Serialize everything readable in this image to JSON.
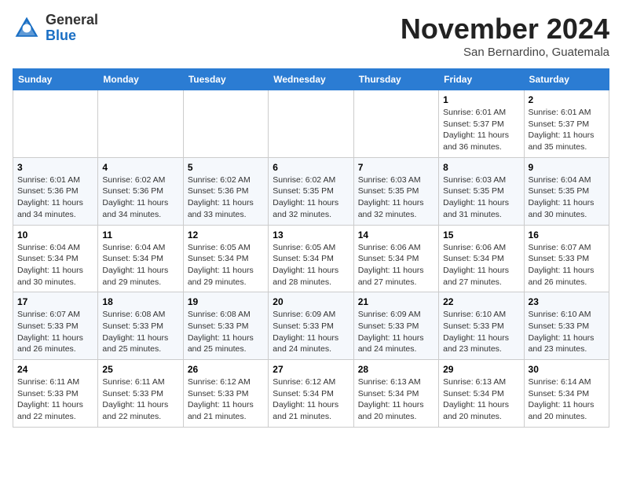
{
  "header": {
    "logo_line1": "General",
    "logo_line2": "Blue",
    "month": "November 2024",
    "location": "San Bernardino, Guatemala"
  },
  "weekdays": [
    "Sunday",
    "Monday",
    "Tuesday",
    "Wednesday",
    "Thursday",
    "Friday",
    "Saturday"
  ],
  "weeks": [
    [
      {
        "day": "",
        "info": ""
      },
      {
        "day": "",
        "info": ""
      },
      {
        "day": "",
        "info": ""
      },
      {
        "day": "",
        "info": ""
      },
      {
        "day": "",
        "info": ""
      },
      {
        "day": "1",
        "info": "Sunrise: 6:01 AM\nSunset: 5:37 PM\nDaylight: 11 hours and 36 minutes."
      },
      {
        "day": "2",
        "info": "Sunrise: 6:01 AM\nSunset: 5:37 PM\nDaylight: 11 hours and 35 minutes."
      }
    ],
    [
      {
        "day": "3",
        "info": "Sunrise: 6:01 AM\nSunset: 5:36 PM\nDaylight: 11 hours and 34 minutes."
      },
      {
        "day": "4",
        "info": "Sunrise: 6:02 AM\nSunset: 5:36 PM\nDaylight: 11 hours and 34 minutes."
      },
      {
        "day": "5",
        "info": "Sunrise: 6:02 AM\nSunset: 5:36 PM\nDaylight: 11 hours and 33 minutes."
      },
      {
        "day": "6",
        "info": "Sunrise: 6:02 AM\nSunset: 5:35 PM\nDaylight: 11 hours and 32 minutes."
      },
      {
        "day": "7",
        "info": "Sunrise: 6:03 AM\nSunset: 5:35 PM\nDaylight: 11 hours and 32 minutes."
      },
      {
        "day": "8",
        "info": "Sunrise: 6:03 AM\nSunset: 5:35 PM\nDaylight: 11 hours and 31 minutes."
      },
      {
        "day": "9",
        "info": "Sunrise: 6:04 AM\nSunset: 5:35 PM\nDaylight: 11 hours and 30 minutes."
      }
    ],
    [
      {
        "day": "10",
        "info": "Sunrise: 6:04 AM\nSunset: 5:34 PM\nDaylight: 11 hours and 30 minutes."
      },
      {
        "day": "11",
        "info": "Sunrise: 6:04 AM\nSunset: 5:34 PM\nDaylight: 11 hours and 29 minutes."
      },
      {
        "day": "12",
        "info": "Sunrise: 6:05 AM\nSunset: 5:34 PM\nDaylight: 11 hours and 29 minutes."
      },
      {
        "day": "13",
        "info": "Sunrise: 6:05 AM\nSunset: 5:34 PM\nDaylight: 11 hours and 28 minutes."
      },
      {
        "day": "14",
        "info": "Sunrise: 6:06 AM\nSunset: 5:34 PM\nDaylight: 11 hours and 27 minutes."
      },
      {
        "day": "15",
        "info": "Sunrise: 6:06 AM\nSunset: 5:34 PM\nDaylight: 11 hours and 27 minutes."
      },
      {
        "day": "16",
        "info": "Sunrise: 6:07 AM\nSunset: 5:33 PM\nDaylight: 11 hours and 26 minutes."
      }
    ],
    [
      {
        "day": "17",
        "info": "Sunrise: 6:07 AM\nSunset: 5:33 PM\nDaylight: 11 hours and 26 minutes."
      },
      {
        "day": "18",
        "info": "Sunrise: 6:08 AM\nSunset: 5:33 PM\nDaylight: 11 hours and 25 minutes."
      },
      {
        "day": "19",
        "info": "Sunrise: 6:08 AM\nSunset: 5:33 PM\nDaylight: 11 hours and 25 minutes."
      },
      {
        "day": "20",
        "info": "Sunrise: 6:09 AM\nSunset: 5:33 PM\nDaylight: 11 hours and 24 minutes."
      },
      {
        "day": "21",
        "info": "Sunrise: 6:09 AM\nSunset: 5:33 PM\nDaylight: 11 hours and 24 minutes."
      },
      {
        "day": "22",
        "info": "Sunrise: 6:10 AM\nSunset: 5:33 PM\nDaylight: 11 hours and 23 minutes."
      },
      {
        "day": "23",
        "info": "Sunrise: 6:10 AM\nSunset: 5:33 PM\nDaylight: 11 hours and 23 minutes."
      }
    ],
    [
      {
        "day": "24",
        "info": "Sunrise: 6:11 AM\nSunset: 5:33 PM\nDaylight: 11 hours and 22 minutes."
      },
      {
        "day": "25",
        "info": "Sunrise: 6:11 AM\nSunset: 5:33 PM\nDaylight: 11 hours and 22 minutes."
      },
      {
        "day": "26",
        "info": "Sunrise: 6:12 AM\nSunset: 5:33 PM\nDaylight: 11 hours and 21 minutes."
      },
      {
        "day": "27",
        "info": "Sunrise: 6:12 AM\nSunset: 5:34 PM\nDaylight: 11 hours and 21 minutes."
      },
      {
        "day": "28",
        "info": "Sunrise: 6:13 AM\nSunset: 5:34 PM\nDaylight: 11 hours and 20 minutes."
      },
      {
        "day": "29",
        "info": "Sunrise: 6:13 AM\nSunset: 5:34 PM\nDaylight: 11 hours and 20 minutes."
      },
      {
        "day": "30",
        "info": "Sunrise: 6:14 AM\nSunset: 5:34 PM\nDaylight: 11 hours and 20 minutes."
      }
    ]
  ]
}
